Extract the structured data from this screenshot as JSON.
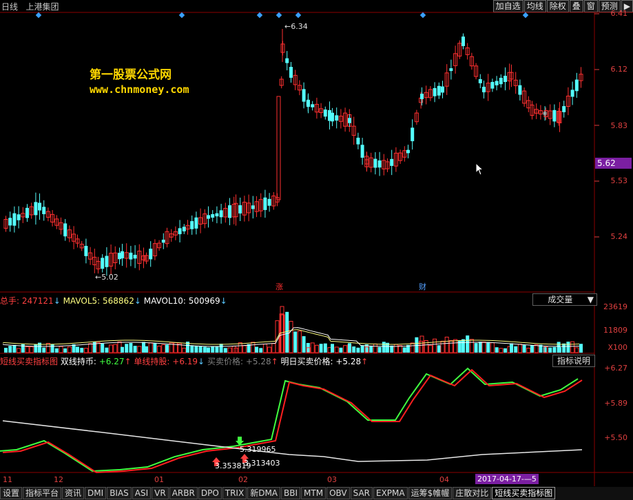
{
  "topbar": {
    "period": "日线",
    "stock_name": "上港集团",
    "buttons": [
      "加自选",
      "均线",
      "除权",
      "叠",
      "窗",
      "预测",
      "▶"
    ]
  },
  "watermark": {
    "line1": "第一股票公式网",
    "line2": "www.chnmoney.com"
  },
  "price_panel": {
    "y_labels": [
      "6.41",
      "6.12",
      "5.83",
      "5.53",
      "5.24"
    ],
    "current_price": "5.62",
    "annotations": {
      "high": "6.34",
      "low": "5.02"
    },
    "markers": {
      "zhang": "涨",
      "cai": "财"
    },
    "colors": {
      "up": "#ff3030",
      "down": "#54fcfc",
      "current_bg": "#7b1fa2"
    }
  },
  "volume_panel": {
    "total_label": "总手:",
    "total_value": "247121",
    "mavol5_label": "MAVOL5:",
    "mavol5_value": "568862",
    "mavol10_label": "MAVOL10:",
    "mavol10_value": "500969",
    "dropdown": "成交量",
    "y_labels": [
      "23619",
      "11809",
      "X100"
    ]
  },
  "indicator_panel": {
    "name": "短线买卖指标图",
    "shuang_label": "双线持币:",
    "shuang_value": "+6.27",
    "dan_label": "单线持股:",
    "dan_value": "+6.19",
    "price_label": "买卖价格:",
    "price_value": "+5.28",
    "tomorrow_label": "明日买卖价格:",
    "tomorrow_value": "+5.28",
    "help_button": "指标说明",
    "y_labels": [
      "+6.27",
      "+5.89",
      "+5.50"
    ],
    "annotations": [
      "5.319965",
      "3.353819",
      "3.313403"
    ]
  },
  "x_axis": {
    "labels": [
      "11",
      "12",
      "01",
      "02",
      "03",
      "04"
    ],
    "date_highlight": "2017-04-17-—5"
  },
  "tabs": [
    "设置",
    "指标平台",
    "资讯",
    "DMI",
    "BIAS",
    "ASI",
    "VR",
    "ARBR",
    "DPO",
    "TRIX",
    "新DMA",
    "BBI",
    "MTM",
    "OBV",
    "SAR",
    "EXPMA",
    "运筹$帷幄",
    "庄散对比",
    "短线买卖指标图"
  ]
}
